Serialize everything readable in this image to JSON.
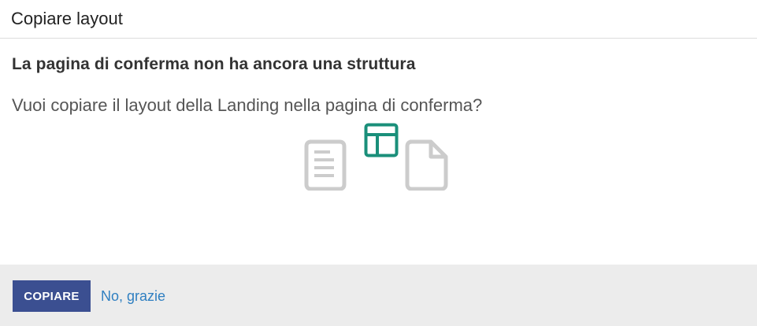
{
  "dialog": {
    "title": "Copiare layout",
    "heading": "La pagina di conferma non ha ancora una struttura",
    "question": "Vuoi copiare il layout della Landing nella pagina di conferma?"
  },
  "illustration": {
    "icons": [
      "document-lines-icon",
      "layout-icon",
      "document-blank-icon"
    ],
    "colors": {
      "document": "#cccccc",
      "layout": "#1a8f7a"
    }
  },
  "footer": {
    "copy_label": "COPIARE",
    "decline_label": "No, grazie",
    "colors": {
      "primary_button": "#3b4f91",
      "link": "#2f7fc1",
      "background": "#ececec"
    }
  }
}
